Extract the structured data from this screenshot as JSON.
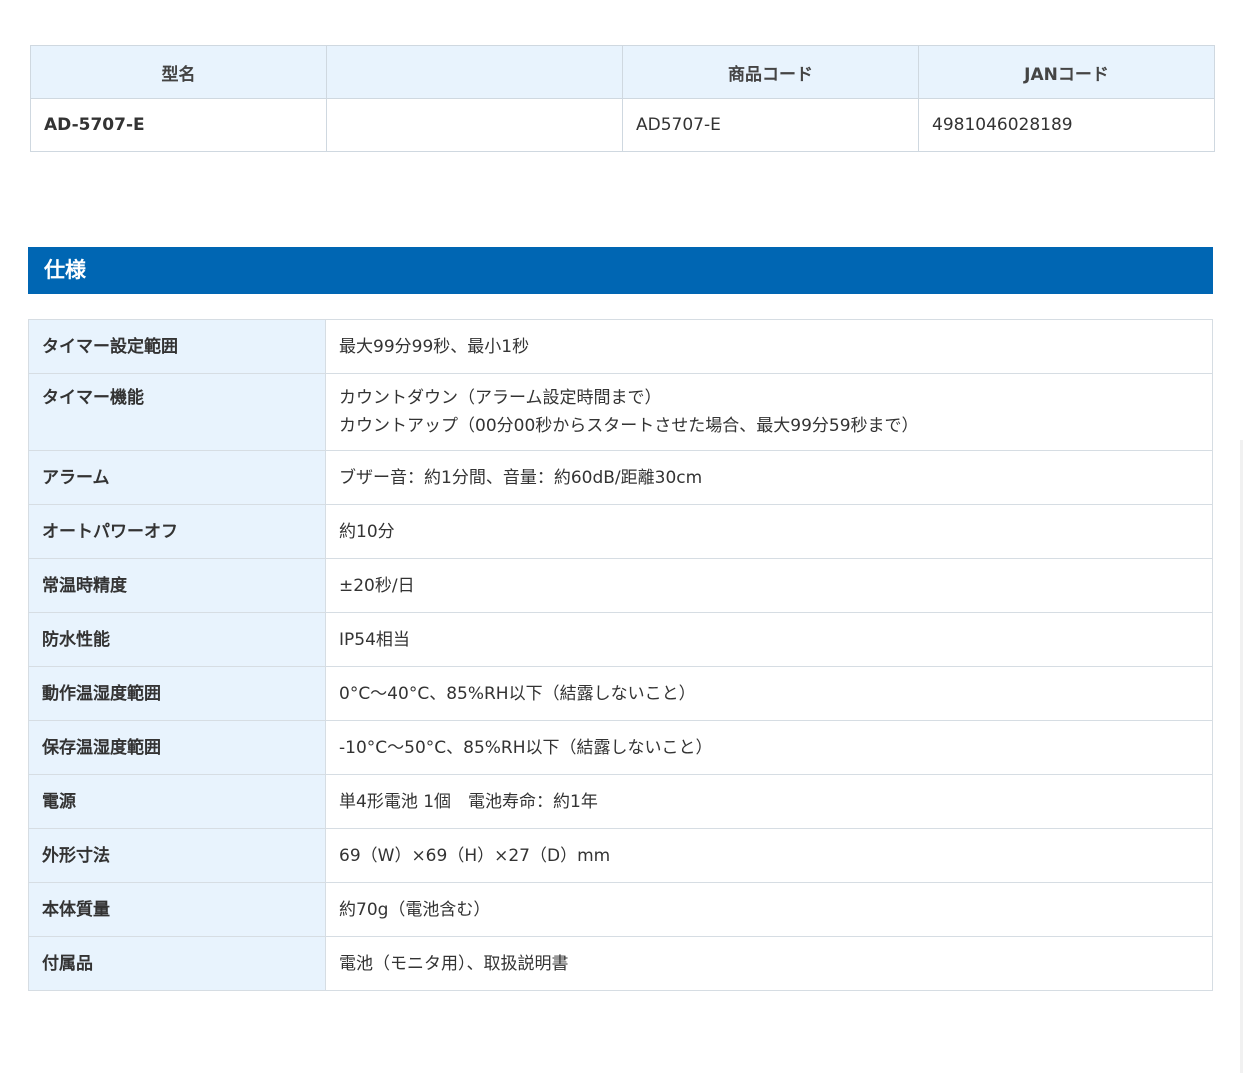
{
  "product_table": {
    "headers": [
      "型名",
      "",
      "商品コード",
      "JANコード"
    ],
    "row": [
      "AD-5707-E",
      "",
      "AD5707-E",
      "4981046028189"
    ]
  },
  "spec_heading": "仕様",
  "specs": [
    {
      "label": "タイマー設定範囲",
      "lines": [
        "最大99分99秒、最小1秒"
      ]
    },
    {
      "label": "タイマー機能",
      "lines": [
        "カウントダウン（アラーム設定時間まで）",
        "カウントアップ（00分00秒からスタートさせた場合、最大99分59秒まで）"
      ]
    },
    {
      "label": "アラーム",
      "lines": [
        "ブザー音：約1分間、音量：約60dB/距離30cm"
      ]
    },
    {
      "label": "オートパワーオフ",
      "lines": [
        "約10分"
      ]
    },
    {
      "label": "常温時精度",
      "lines": [
        "±20秒/日"
      ]
    },
    {
      "label": "防水性能",
      "lines": [
        "IP54相当"
      ]
    },
    {
      "label": "動作温湿度範囲",
      "lines": [
        "0°C〜40°C、85%RH以下（結露しないこと）"
      ]
    },
    {
      "label": "保存温湿度範囲",
      "lines": [
        "-10°C〜50°C、85%RH以下（結露しないこと）"
      ]
    },
    {
      "label": "電源",
      "lines": [
        "単4形電池 1個　電池寿命：約1年"
      ]
    },
    {
      "label": "外形寸法",
      "lines": [
        "69（W）×69（H）×27（D）mm"
      ]
    },
    {
      "label": "本体質量",
      "lines": [
        "約70g（電池含む）"
      ]
    },
    {
      "label": "付属品",
      "lines": [
        "電池（モニタ用）、取扱説明書"
      ]
    }
  ]
}
